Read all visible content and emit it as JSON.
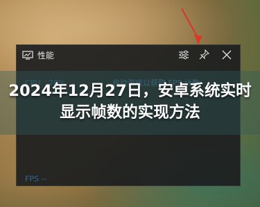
{
  "window": {
    "title": "性能"
  },
  "icons": [
    "performance-icon",
    "settings-icon",
    "pin-icon",
    "close-icon"
  ],
  "metrics": {
    "cpu_label": "CPU",
    "cpu_value": "70%",
    "fps_hint": "启动游戏以获取 FPS 计数",
    "fps_line": "FPS --"
  },
  "headline": "2024年12月27日，安卓系统实时显示帧数的实现方法",
  "colors": {
    "arrow": "#d8392a",
    "panel": "#1c1e20",
    "metric_text": "#3b8de0",
    "overlay": "#2e5c5c"
  }
}
